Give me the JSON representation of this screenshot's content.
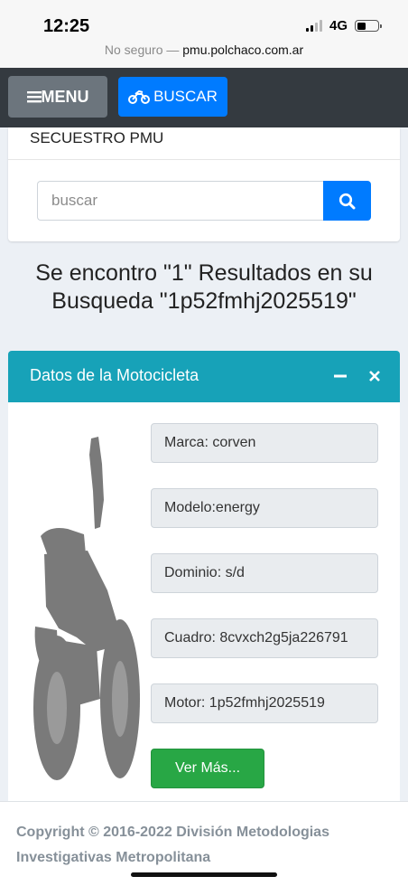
{
  "status_bar": {
    "time": "12:25",
    "network": "4G"
  },
  "browser": {
    "security_label": "No seguro",
    "separator": "—",
    "domain": "pmu.polchaco.com.ar"
  },
  "navbar": {
    "menu_label": "MENU",
    "buscar_label": "BUSCAR"
  },
  "search_card": {
    "title": "SECUESTRO PMU",
    "placeholder": "buscar"
  },
  "results": {
    "line1": "Se encontro \"1\" Resultados en su",
    "line2": "Busqueda \"1p52fmhj2025519\""
  },
  "moto_card": {
    "title": "Datos de la Motocicleta",
    "fields": {
      "marca": "Marca: corven",
      "modelo": "Modelo:energy",
      "dominio": "Dominio: s/d",
      "cuadro": "Cuadro: 8cvxch2g5ja226791",
      "motor": "Motor: 1p52fmhj2025519"
    },
    "ver_mas_label": "Ver Más..."
  },
  "footer": {
    "copyright": "Copyright © 2016-2022 División Metodologias Investigativas Metropolitana"
  },
  "colors": {
    "navbar": "#343a40",
    "primary": "#007bff",
    "info": "#17a2b8",
    "success": "#28a745",
    "secondary": "#6c757d"
  },
  "icons": {
    "menu": "hamburger-icon",
    "buscar": "motorcycle-icon",
    "search": "search-icon",
    "minimize": "minus-icon",
    "close": "close-icon"
  }
}
